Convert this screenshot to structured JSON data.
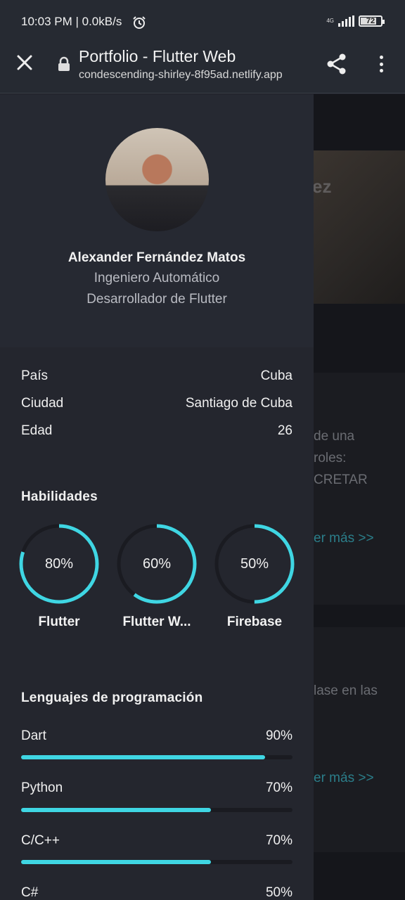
{
  "status_bar": {
    "time": "10:03 PM | 0.0kB/s",
    "network": "4G",
    "battery": "72"
  },
  "browser": {
    "title": "Portfolio - Flutter Web",
    "url": "condescending-shirley-8f95ad.netlify.app"
  },
  "background_page": {
    "hero_text": "ez",
    "card1_lines": [
      "de una",
      "roles:",
      "CRETAR"
    ],
    "card1_link": "er más >>",
    "card2_line": "lase en las",
    "card2_link": "er más >>"
  },
  "profile": {
    "name": "Alexander Fernández Matos",
    "role1": "Ingeniero Automático",
    "role2": "Desarrollador de Flutter"
  },
  "info": [
    {
      "label": "País",
      "value": "Cuba"
    },
    {
      "label": "Ciudad",
      "value": "Santiago de Cuba"
    },
    {
      "label": "Edad",
      "value": "26"
    }
  ],
  "skills": {
    "title": "Habilidades",
    "items": [
      {
        "label": "Flutter",
        "percent_text": "80%",
        "value": 0.8
      },
      {
        "label": "Flutter W...",
        "percent_text": "60%",
        "value": 0.6
      },
      {
        "label": "Firebase",
        "percent_text": "50%",
        "value": 0.5
      }
    ]
  },
  "languages": {
    "title": "Lenguajes de programación",
    "items": [
      {
        "label": "Dart",
        "percent_text": "90%",
        "value": 0.9
      },
      {
        "label": "Python",
        "percent_text": "70%",
        "value": 0.7
      },
      {
        "label": "C/C++",
        "percent_text": "70%",
        "value": 0.7
      },
      {
        "label": "C#",
        "percent_text": "50%",
        "value": 0.5
      }
    ]
  },
  "colors": {
    "accent": "#3fd6e3",
    "drawer": "#24262e",
    "track": "#1a1b21"
  }
}
